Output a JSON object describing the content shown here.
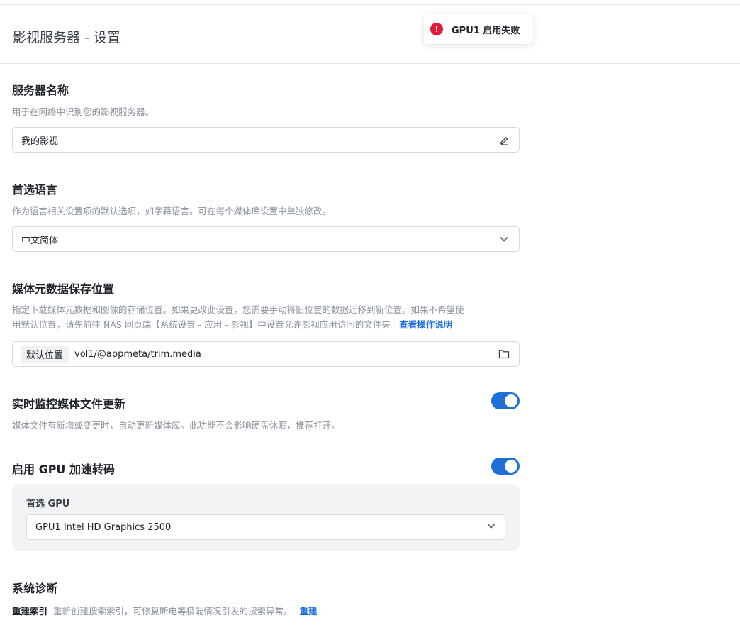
{
  "header": {
    "title": "影视服务器 - 设置"
  },
  "toast": {
    "icon": "error-icon",
    "text": "GPU1 启用失败"
  },
  "server_name": {
    "title": "服务器名称",
    "desc": "用于在网络中识别您的影视服务器。",
    "value": "我的影视",
    "icon": "edit-icon"
  },
  "language": {
    "title": "首选语言",
    "desc": "作为语言相关设置项的默认选项，如字幕语言。可在每个媒体库设置中单独修改。",
    "value": "中文简体",
    "icon": "chevron-down-icon"
  },
  "metadata": {
    "title": "媒体元数据保存位置",
    "desc_line1": "指定下载媒体元数据和图像的存储位置。如果更改此设置，您需要手动将旧位置的数据迁移到新位置。如果不希望使",
    "desc_line2": "用默认位置，请先前往 NAS 网页端【系统设置 - 应用 - 影视】中设置允许影视应用访问的文件夹。",
    "link": "查看操作说明",
    "tag": "默认位置",
    "path": "vol1/@appmeta/trim.media",
    "icon": "folder-icon"
  },
  "monitor": {
    "title": "实时监控媒体文件更新",
    "desc": "媒体文件有新增或变更时，自动更新媒体库。此功能不会影响硬盘休眠，推荐打开。",
    "enabled": true
  },
  "gpu": {
    "title": "启用 GPU 加速转码",
    "enabled": true,
    "label": "首选 GPU",
    "value": "GPU1 Intel HD Graphics 2500"
  },
  "diagnostics": {
    "title": "系统诊断",
    "item_name": "重建索引",
    "item_desc": "重新创建搜索索引，可修复断电等极端情况引发的搜索异常。",
    "action": "重建"
  },
  "colors": {
    "accent": "#1f6fd6",
    "error": "#e5193a",
    "link": "#1a6fdb"
  }
}
